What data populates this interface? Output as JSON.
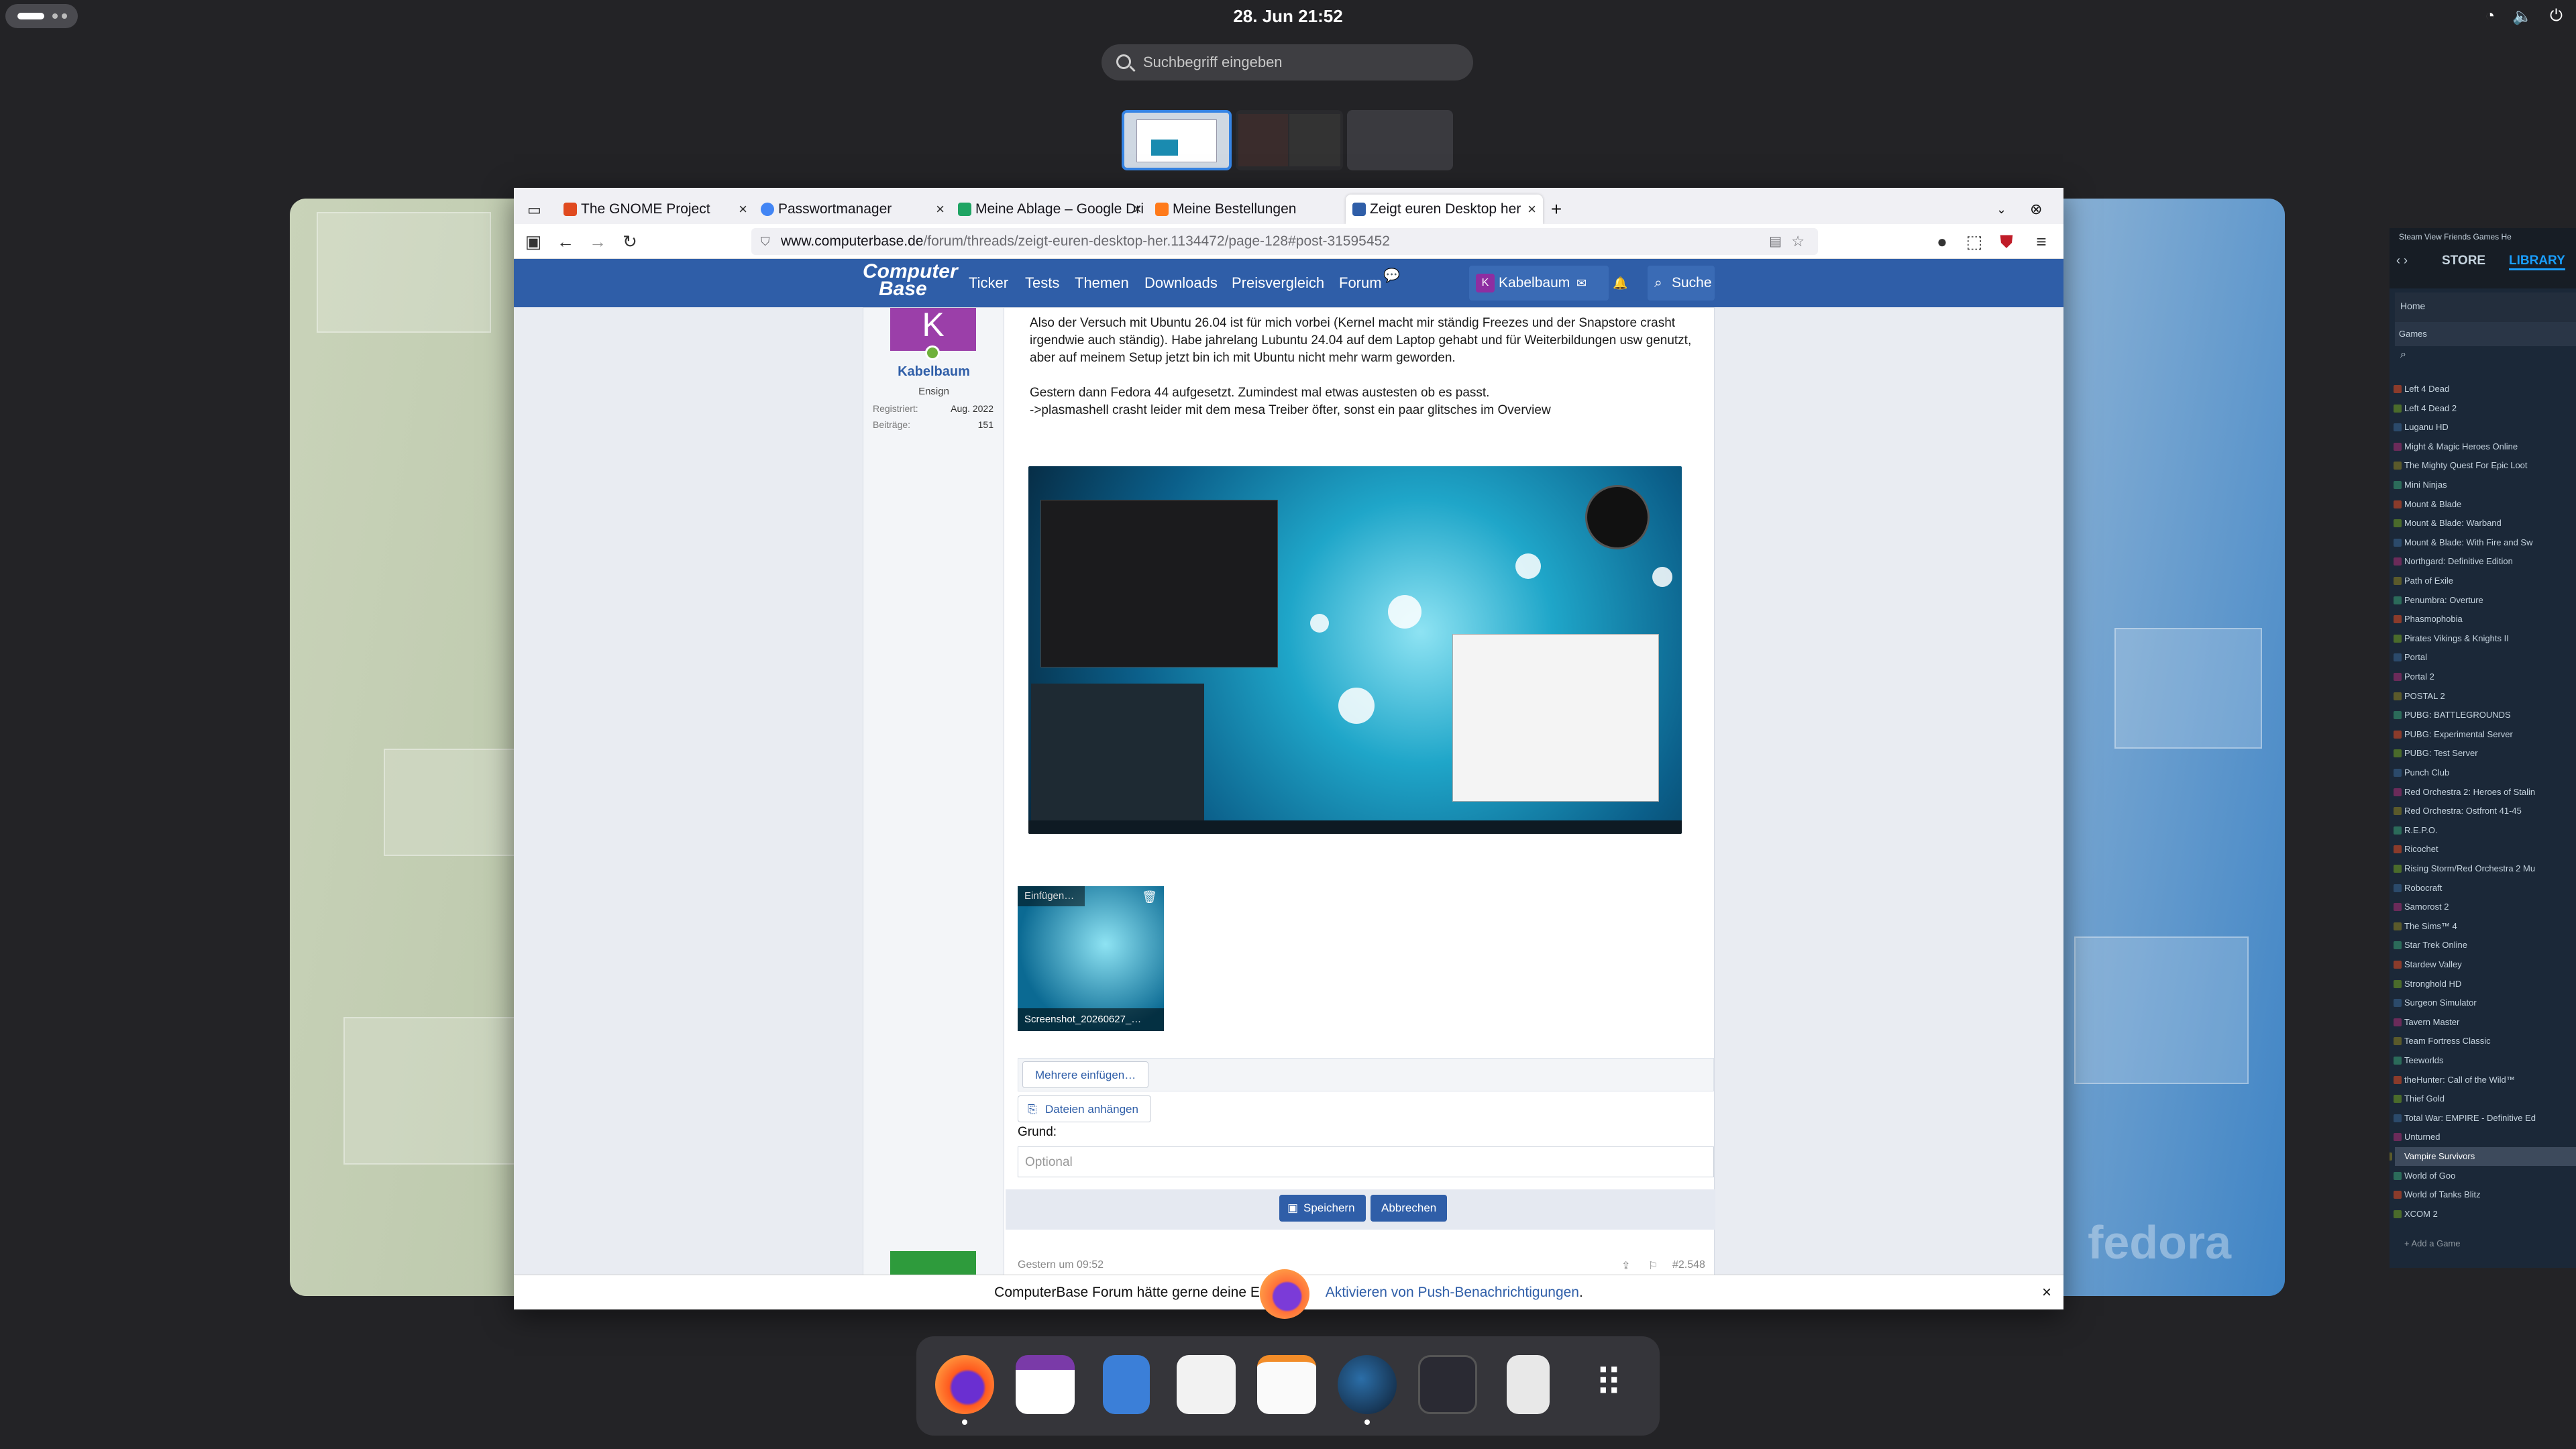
{
  "topbar": {
    "clock": "28. Jun  21:52"
  },
  "search": {
    "placeholder": "Suchbegriff eingeben"
  },
  "browser": {
    "tabs": [
      {
        "label": "The GNOME Project",
        "color": "#e04a1f"
      },
      {
        "label": "Passwortmanager",
        "color": "#4285f4"
      },
      {
        "label": "Meine Ablage – Google Dri",
        "color": "#1fa463"
      },
      {
        "label": "Meine Bestellungen",
        "color": "#ff7a1a"
      },
      {
        "label": "Zeigt euren Desktop her",
        "color": "#2f5ea8"
      }
    ],
    "url_domain": "www.computerbase.de",
    "url_path": "/forum/threads/zeigt-euren-desktop-her.1134472/page-128#post-31595452"
  },
  "site": {
    "logo_line1": "Computer",
    "logo_line2": "Base",
    "nav": [
      "Ticker",
      "Tests",
      "Themen",
      "Downloads",
      "Preisvergleich",
      "Forum"
    ],
    "user": "Kabelbaum",
    "user_initial": "K",
    "search_label": "Suche"
  },
  "post": {
    "avatar_letter": "K",
    "username": "Kabelbaum",
    "rank": "Ensign",
    "registered_label": "Registriert:",
    "registered_value": "Aug. 2022",
    "posts_label": "Beiträge:",
    "posts_value": "151",
    "p1": "Also der Versuch mit Ubuntu 26.04 ist für mich vorbei (Kernel macht mir ständig Freezes und der Snapstore crasht irgendwie auch ständig). Habe jahrelang Lubuntu 24.04 auf dem Laptop gehabt und für Weiterbildungen usw genutzt, aber auf meinem Setup jetzt bin ich mit Ubuntu nicht mehr warm geworden.",
    "p2": "Gestern dann Fedora 44 aufgesetzt. Zumindest mal etwas austesten ob es passt.",
    "p3": "->plasmashell crasht leider mit dem mesa Treiber öfter, sonst ein paar glitsches im Overview",
    "attach_insert": "Einfügen…",
    "attach_name": "Screenshot_20260627_…",
    "btn_more": "Mehrere einfügen…",
    "btn_attach": "Dateien anhängen",
    "grund_label": "Grund:",
    "grund_placeholder": "Optional",
    "btn_save": "Speichern",
    "btn_cancel": "Abbrechen",
    "next_meta": "Gestern um 09:52",
    "next_num": "#2.548"
  },
  "notification": {
    "text_before": "ComputerBase Forum hätte gerne deine Erla",
    "link": "Aktivieren von Push-Benachrichtigungen",
    "text_after": "."
  },
  "steam": {
    "nav_store": "STORE",
    "nav_library": "LIBRARY",
    "menu": "Steam  View  Friends  Games  He",
    "home": "Home",
    "games_label": "Games",
    "add_game": "Add a Game",
    "games": [
      "Left 4 Dead",
      "Left 4 Dead 2",
      "Luganu HD",
      "Might & Magic Heroes Online",
      "The Mighty Quest For Epic Loot",
      "Mini Ninjas",
      "Mount & Blade",
      "Mount & Blade: Warband",
      "Mount & Blade: With Fire and Sw",
      "Northgard: Definitive Edition",
      "Path of Exile",
      "Penumbra: Overture",
      "Phasmophobia",
      "Pirates Vikings & Knights II",
      "Portal",
      "Portal 2",
      "POSTAL 2",
      "PUBG: BATTLEGROUNDS",
      "PUBG: Experimental Server",
      "PUBG: Test Server",
      "Punch Club",
      "Red Orchestra 2: Heroes of Stalin",
      "Red Orchestra: Ostfront 41-45",
      "R.E.P.O.",
      "Ricochet",
      "Rising Storm/Red Orchestra 2 Mu",
      "Robocraft",
      "Samorost 2",
      "The Sims™ 4",
      "Star Trek Online",
      "Stardew Valley",
      "Stronghold HD",
      "Surgeon Simulator",
      "Tavern Master",
      "Team Fortress Classic",
      "Teeworlds",
      "theHunter: Call of the Wild™",
      "Thief Gold",
      "Total War: EMPIRE - Definitive Ed",
      "Unturned",
      "Vampire Survivors",
      "World of Goo",
      "World of Tanks Blitz",
      "XCOM 2"
    ],
    "selected": "Vampire Survivors"
  },
  "wallpaper_text": "fedora",
  "dock": [
    "firefox-icon",
    "calendar-icon",
    "files-icon",
    "software-icon",
    "text-editor-icon",
    "steam-icon",
    "terminal-icon",
    "calculator-icon",
    "app-grid-icon"
  ]
}
